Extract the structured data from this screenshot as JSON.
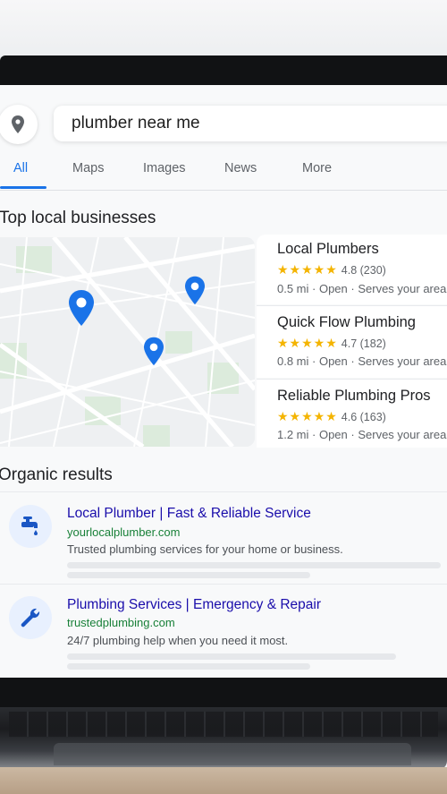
{
  "search": {
    "query": "plumber near me"
  },
  "tabs": [
    {
      "label": "All"
    },
    {
      "label": "Maps"
    },
    {
      "label": "Images"
    },
    {
      "label": "News"
    },
    {
      "label": "More"
    }
  ],
  "local": {
    "title": "Top local businesses",
    "businesses": [
      {
        "name": "Local Plumbers",
        "stars": "★★★★★",
        "rating": "4.8",
        "reviews": "(230)",
        "distance": "0.5 mi",
        "status": "Open",
        "service": "Serves your area"
      },
      {
        "name": "Quick Flow Plumbing",
        "stars": "★★★★★",
        "rating": "4.7",
        "reviews": "(182)",
        "distance": "0.8 mi",
        "status": "Open",
        "service": "Serves your area"
      },
      {
        "name": "Reliable Plumbing Pros",
        "stars": "★★★★★",
        "rating": "4.6",
        "reviews": "(163)",
        "distance": "1.2 mi",
        "status": "Open",
        "service": "Serves your area"
      }
    ]
  },
  "organic": {
    "title": "Organic results",
    "results": [
      {
        "icon": "faucet-icon",
        "title": "Local Plumber | Fast & Reliable Service",
        "url": "yourlocalplumber.com",
        "description": "Trusted plumbing services for your home or business."
      },
      {
        "icon": "wrench-icon",
        "title": "Plumbing Services | Emergency & Repair",
        "url": "trustedplumbing.com",
        "description": "24/7 plumbing help when you need it most."
      }
    ]
  },
  "colors": {
    "accent": "#1a73e8",
    "link": "#1a0dab",
    "url": "#188038",
    "star": "#f4b400"
  }
}
